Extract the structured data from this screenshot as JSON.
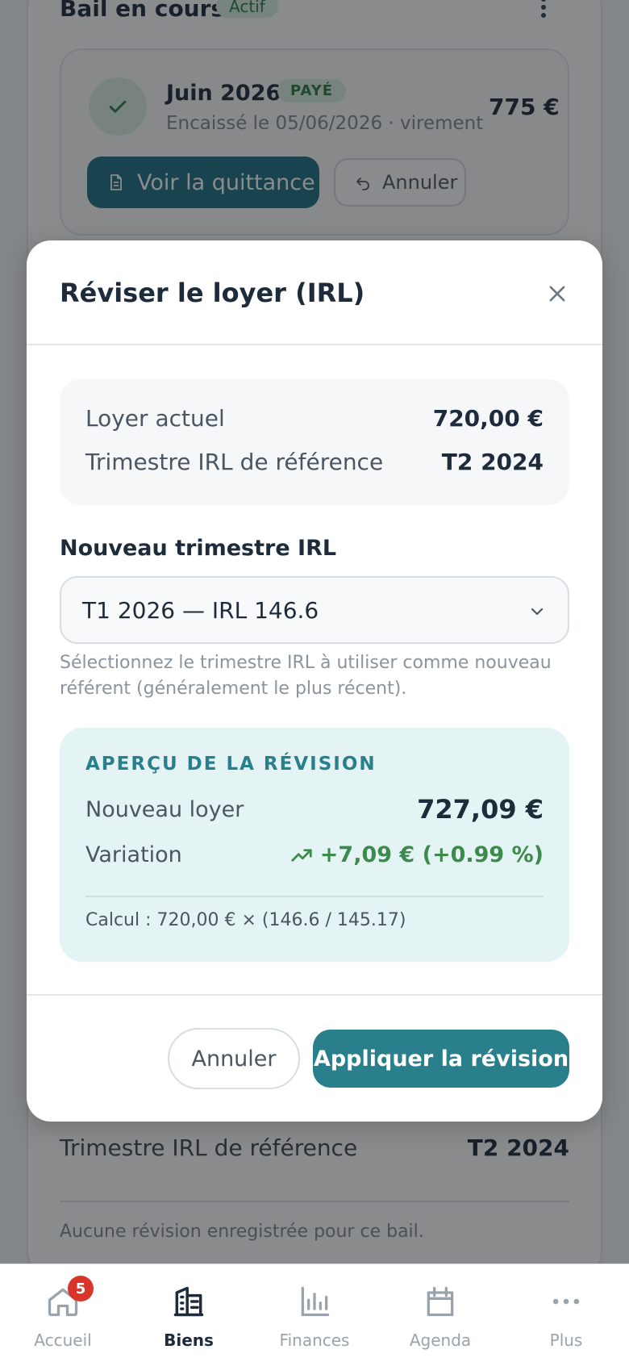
{
  "background": {
    "lease_title": "Bail en cours",
    "lease_status": "Actif",
    "payment": {
      "month": "Juin 2026",
      "status": "PAYÉ",
      "amount": "775 €",
      "detail": "Encaissé le 05/06/2026 · virement",
      "receipt_button": "Voir la quittance",
      "cancel_button": "Annuler"
    },
    "ref_label": "Trimestre IRL de référence",
    "ref_value": "T2 2024",
    "no_revision": "Aucune révision enregistrée pour ce bail."
  },
  "modal": {
    "title": "Réviser le loyer (IRL)",
    "current": {
      "rent_label": "Loyer actuel",
      "rent_value": "720,00 €",
      "quarter_label": "Trimestre IRL de référence",
      "quarter_value": "T2 2024"
    },
    "field_label": "Nouveau trimestre IRL",
    "select_value": "T1 2026 — IRL 146.6",
    "helper": "Sélectionnez le trimestre IRL à utiliser comme nouveau référent (généralement le plus récent).",
    "preview": {
      "title": "APERÇU DE LA RÉVISION",
      "new_rent_label": "Nouveau loyer",
      "new_rent_value": "727,09 €",
      "variation_label": "Variation",
      "variation_value": "+7,09 € (+0.99 %)",
      "calc": "Calcul : 720,00 € × (146.6 / 145.17)"
    },
    "cancel_button": "Annuler",
    "apply_button": "Appliquer la révision"
  },
  "nav": {
    "items": [
      {
        "label": "Accueil",
        "icon": "home-icon",
        "badge": "5"
      },
      {
        "label": "Biens",
        "icon": "buildings-icon"
      },
      {
        "label": "Finances",
        "icon": "bar-chart-icon"
      },
      {
        "label": "Agenda",
        "icon": "calendar-icon"
      },
      {
        "label": "Plus",
        "icon": "more-icon"
      }
    ],
    "active": "Biens"
  },
  "colors": {
    "primary": "#2a7f8c",
    "dark_primary": "#1f6e80",
    "success": "#3d8a4d",
    "badge": "#d9352b"
  }
}
